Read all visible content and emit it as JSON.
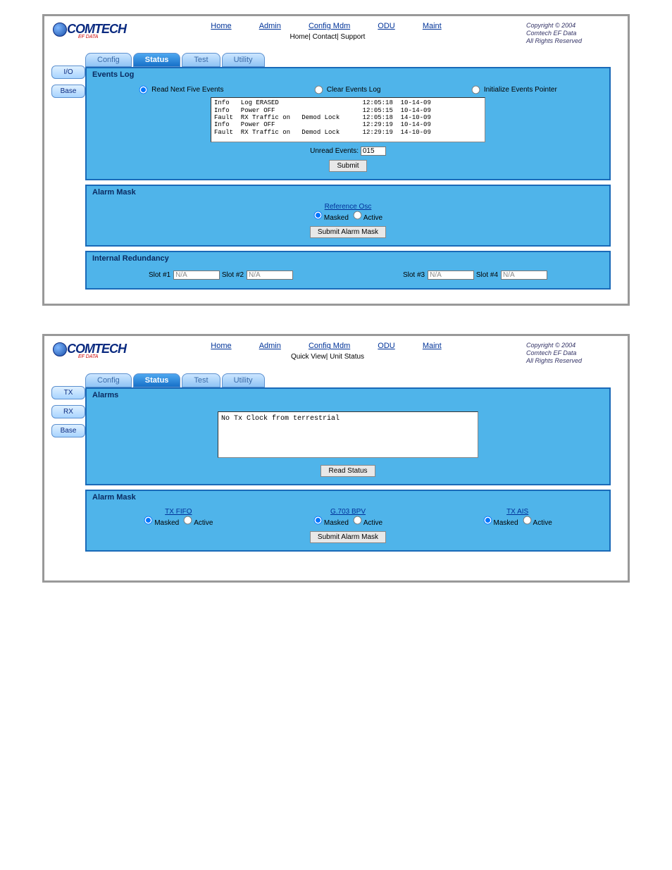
{
  "brand": {
    "name": "COMTECH",
    "sub": "EF DATA"
  },
  "copyright": {
    "l1": "Copyright © 2004",
    "l2": "Comtech EF Data",
    "l3": "All Rights Reserved"
  },
  "nav": {
    "home": "Home",
    "admin": "Admin",
    "config": "Config Mdm",
    "odu": "ODU",
    "maint": "Maint"
  },
  "sub1": {
    "line": "Home| Contact| Support"
  },
  "sub2": {
    "line": "Quick View| Unit Status"
  },
  "tabs": {
    "config": "Config",
    "status": "Status",
    "test": "Test",
    "utility": "Utility"
  },
  "side1": {
    "a": "I/O",
    "b": "Base"
  },
  "side2": {
    "a": "TX",
    "b": "RX",
    "c": "Base"
  },
  "s1": {
    "events": {
      "title": "Events Log",
      "r1": "Read Next Five Events",
      "r2": "Clear Events Log",
      "r3": "Initialize Events Pointer",
      "log": "Info   Log ERASED                      12:05:18  10-14-09\nInfo   Power OFF                       12:05:15  10-14-09\nFault  RX Traffic on   Demod Lock      12:05:18  14-10-09\nInfo   Power OFF                       12:29:19  10-14-09\nFault  RX Traffic on   Demod Lock      12:29:19  14-10-09",
      "unread_label": "Unread Events:",
      "unread_value": "015",
      "submit": "Submit"
    },
    "mask": {
      "title": "Alarm Mask",
      "ref": "Reference Osc",
      "masked": "Masked",
      "active": "Active",
      "submit": "Submit Alarm Mask"
    },
    "red": {
      "title": "Internal Redundancy",
      "s1l": "Slot #1",
      "s1v": "N/A",
      "s2l": "Slot #2",
      "s2v": "N/A",
      "s3l": "Slot #3",
      "s3v": "N/A",
      "s4l": "Slot #4",
      "s4v": "N/A"
    }
  },
  "s2": {
    "alarms": {
      "title": "Alarms",
      "text": "No Tx Clock from terrestrial",
      "read": "Read Status"
    },
    "mask": {
      "title": "Alarm Mask",
      "c1": "TX FIFO",
      "c2": "G.703 BPV",
      "c3": "TX AIS",
      "masked": "Masked",
      "active": "Active",
      "submit": "Submit Alarm Mask"
    }
  }
}
